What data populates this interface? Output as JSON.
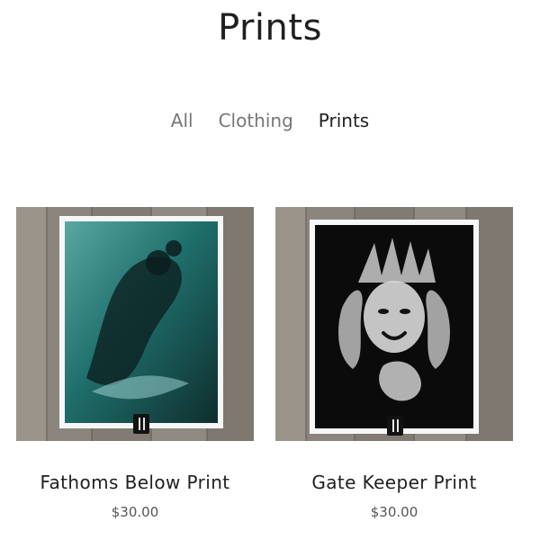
{
  "page": {
    "title": "Prints"
  },
  "filters": [
    {
      "label": "All",
      "active": false
    },
    {
      "label": "Clothing",
      "active": false
    },
    {
      "label": "Prints",
      "active": true
    }
  ],
  "products": [
    {
      "name": "Fathoms Below Print",
      "price": "$30.00",
      "image": "mermaid-print-image"
    },
    {
      "name": "Gate Keeper Print",
      "price": "$30.00",
      "image": "queen-print-image"
    }
  ],
  "colors": {
    "title": "#1f1f1f",
    "filter_inactive": "#777777",
    "filter_active": "#222222",
    "price": "#555555",
    "wood": "#8a847c",
    "teal": "#1f6f6c"
  }
}
